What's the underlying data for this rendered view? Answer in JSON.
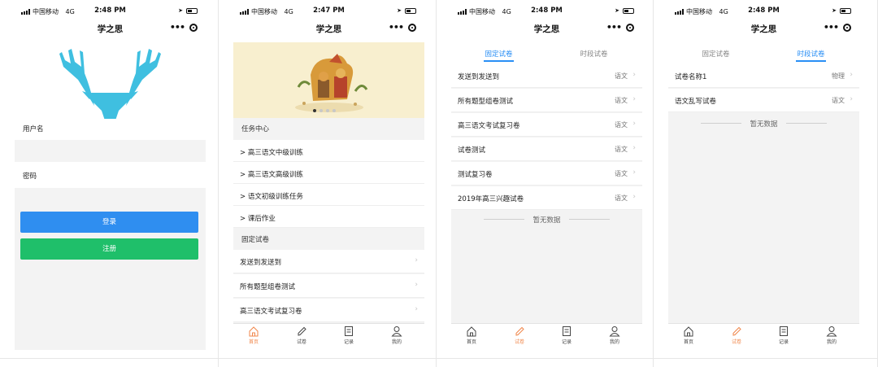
{
  "status": {
    "carrier": "中国移动",
    "network": "4G"
  },
  "frames": [
    {
      "time": "2:48 PM",
      "title": "学之思",
      "login": {
        "username_label": "用户名",
        "password_label": "密码",
        "login_button": "登录",
        "register_button": "注册"
      },
      "colors": {
        "logo": "#3fbfe0",
        "login": "#2f8ef0",
        "register": "#1fbf6a"
      }
    },
    {
      "time": "2:47 PM",
      "title": "学之思",
      "task_center": "任务中心",
      "tasks": [
        "> 高三语文中级训练",
        "> 高三语文高级训练",
        "> 语文初级训练任务",
        "> 课后作业"
      ],
      "fixed_section": "固定试卷",
      "papers": [
        "发送到发送到",
        "所有题型组卷测试",
        "高三语文考试复习卷"
      ],
      "carousel_dots": 4
    },
    {
      "time": "2:48 PM",
      "title": "学之思",
      "tabs": [
        "固定试卷",
        "时段试卷"
      ],
      "active_tab": 0,
      "rows": [
        {
          "name": "发送到发送到",
          "subject": "语文"
        },
        {
          "name": "所有题型组卷测试",
          "subject": "语文"
        },
        {
          "name": "高三语文考试复习卷",
          "subject": "语文"
        },
        {
          "name": "试卷测试",
          "subject": "语文"
        },
        {
          "name": "测试复习卷",
          "subject": "语文"
        },
        {
          "name": "2019年高三兴趣试卷",
          "subject": "语文"
        }
      ],
      "empty_text": "暂无数据"
    },
    {
      "time": "2:48 PM",
      "title": "学之思",
      "tabs": [
        "固定试卷",
        "时段试卷"
      ],
      "active_tab": 1,
      "rows": [
        {
          "name": "试卷名称1",
          "subject": "物理"
        },
        {
          "name": "语文乱写试卷",
          "subject": "语文"
        }
      ],
      "empty_text": "暂无数据"
    }
  ],
  "tabbar": [
    "首页",
    "试卷",
    "记录",
    "我的"
  ],
  "accent": "#2a8ff5",
  "active_tabbar_color": "#f0864a"
}
